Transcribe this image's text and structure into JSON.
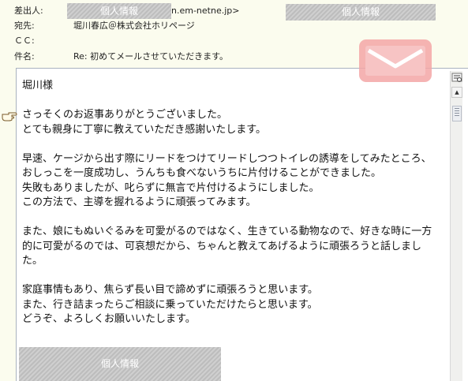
{
  "header": {
    "from_label": "差出人:",
    "from_value_visible": "n.em-netne.jp>",
    "to_label": "宛先:",
    "to_value": "堀川春広＠株式会社ホリページ",
    "cc_label": "ＣＣ:",
    "subject_label": "件名:",
    "subject_value": "Re: 初めてメールさせていただきます。"
  },
  "redactions": {
    "label": "個人情報"
  },
  "icons": {
    "mail": "envelope-icon",
    "pointer": "hand-pointer-icon",
    "scroll_tool": "scroll-tool-icon"
  },
  "message": {
    "greeting": "堀川様",
    "p1": "さっそくのお返事ありがとうございました。\nとても親身に丁寧に教えていただき感謝いたします。",
    "p2": "早速、ケージから出す際にリードをつけてリードしつつトイレの誘導をしてみたところ、おしっこを一度成功し、うんちも食べないうちに片付けることができました。\n失敗もありましたが、叱らずに無言で片付けるようにしました。\nこの方法で、主導を握れるように頑張ってみます。",
    "p3": "また、娘にもぬいぐるみを可愛がるのではなく、生きている動物なので、好きな時に一方的に可愛がるのでは、可哀想だから、ちゃんと教えてあげるように頑張ろうと話しました。",
    "p4": "家庭事情もあり、焦らず長い目で諦めずに頑張ろうと思います。\nまた、行き詰まったらご相談に乗っていただけたらと思います。\nどうぞ、よろしくお願いいたします。"
  },
  "colors": {
    "header_bg": "#fbfcee",
    "envelope": "#f3a6a6"
  }
}
